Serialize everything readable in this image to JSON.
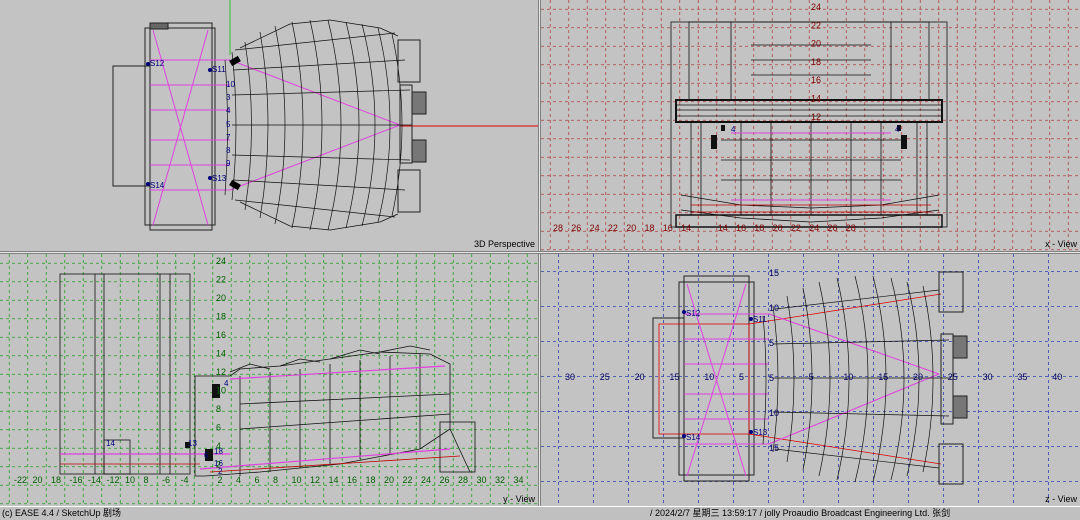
{
  "viewports": {
    "perspective": {
      "label": "3D Perspective",
      "points": [
        "S12",
        "S11",
        "S14",
        "S13",
        "3",
        "4",
        "5",
        "7",
        "8",
        "9",
        "10"
      ]
    },
    "x_view": {
      "label": "x - View",
      "bottom_ticks": [
        "28",
        "26",
        "24",
        "22",
        "20",
        "18",
        "16",
        "14",
        "",
        "14",
        "16",
        "18",
        "20",
        "22",
        "24",
        "26",
        "28"
      ],
      "left_ticks": [
        "24",
        "22",
        "20",
        "18",
        "16",
        "14",
        "12"
      ],
      "points": [
        "4",
        "4",
        "12",
        "14"
      ]
    },
    "y_view": {
      "label": "y - View",
      "bottom_ticks": [
        "-22",
        "20",
        "18",
        "-16",
        "-14",
        "-12",
        "10",
        "8",
        "-6",
        "-4",
        "",
        "2",
        "4",
        "6",
        "8",
        "10",
        "12",
        "14",
        "16",
        "18",
        "20",
        "22",
        "24",
        "26",
        "28",
        "30",
        "32",
        "34"
      ],
      "left_ticks": [
        "24",
        "22",
        "20",
        "18",
        "16",
        "14",
        "12",
        "10",
        "8",
        "6",
        "4",
        "2"
      ],
      "points": [
        "14",
        "13",
        "6",
        "16",
        "18",
        "2",
        "4"
      ]
    },
    "z_view": {
      "label": "z - View",
      "axis_ticks": [
        "30",
        "25",
        "20",
        "15",
        "10",
        "5",
        "",
        "5",
        "10",
        "15",
        "20",
        "25",
        "30",
        "35",
        "40"
      ],
      "vertical_ticks": [
        "15",
        "10",
        "5",
        "5",
        "10",
        "15"
      ],
      "points": [
        "S12",
        "S11",
        "S14",
        "S13"
      ]
    }
  },
  "statusbar": {
    "left": "(c) EASE 4.4  / SketchUp 剧场",
    "right": "/ 2024/2/7 星期三  13:59:17 / jolly Proaudio Broadcast Engineering Ltd. 张剑"
  },
  "colors": {
    "background": "#c3c3c3",
    "grid_x": "#b04040",
    "grid_y": "#20a020",
    "grid_z": "#3040b0",
    "magenta": "#e040e0",
    "axis_red": "#e00000",
    "wire": "#000000"
  }
}
